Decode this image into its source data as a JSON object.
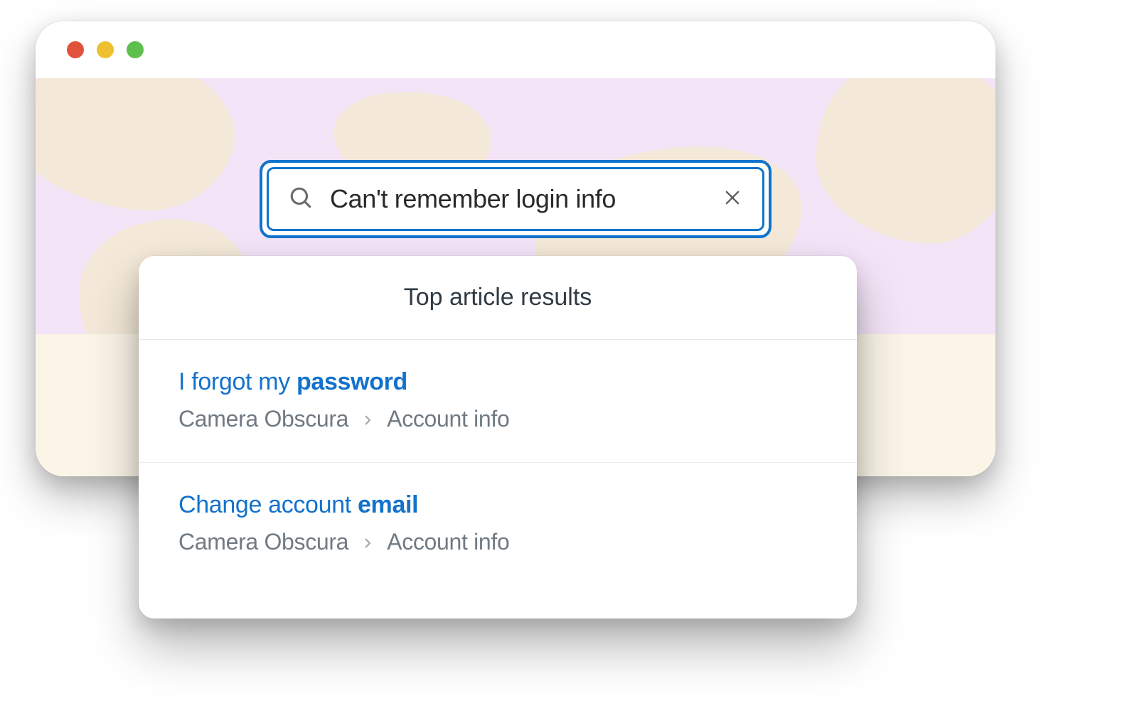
{
  "search": {
    "query": "Can't remember login info"
  },
  "results": {
    "header": "Top article results",
    "items": [
      {
        "title_prefix": "I forgot my ",
        "title_emphasis": "password",
        "bc_root": "Camera Obscura",
        "bc_section": "Account info"
      },
      {
        "title_prefix": "Change account ",
        "title_emphasis": "email",
        "bc_root": "Camera Obscura",
        "bc_section": "Account info"
      }
    ]
  }
}
